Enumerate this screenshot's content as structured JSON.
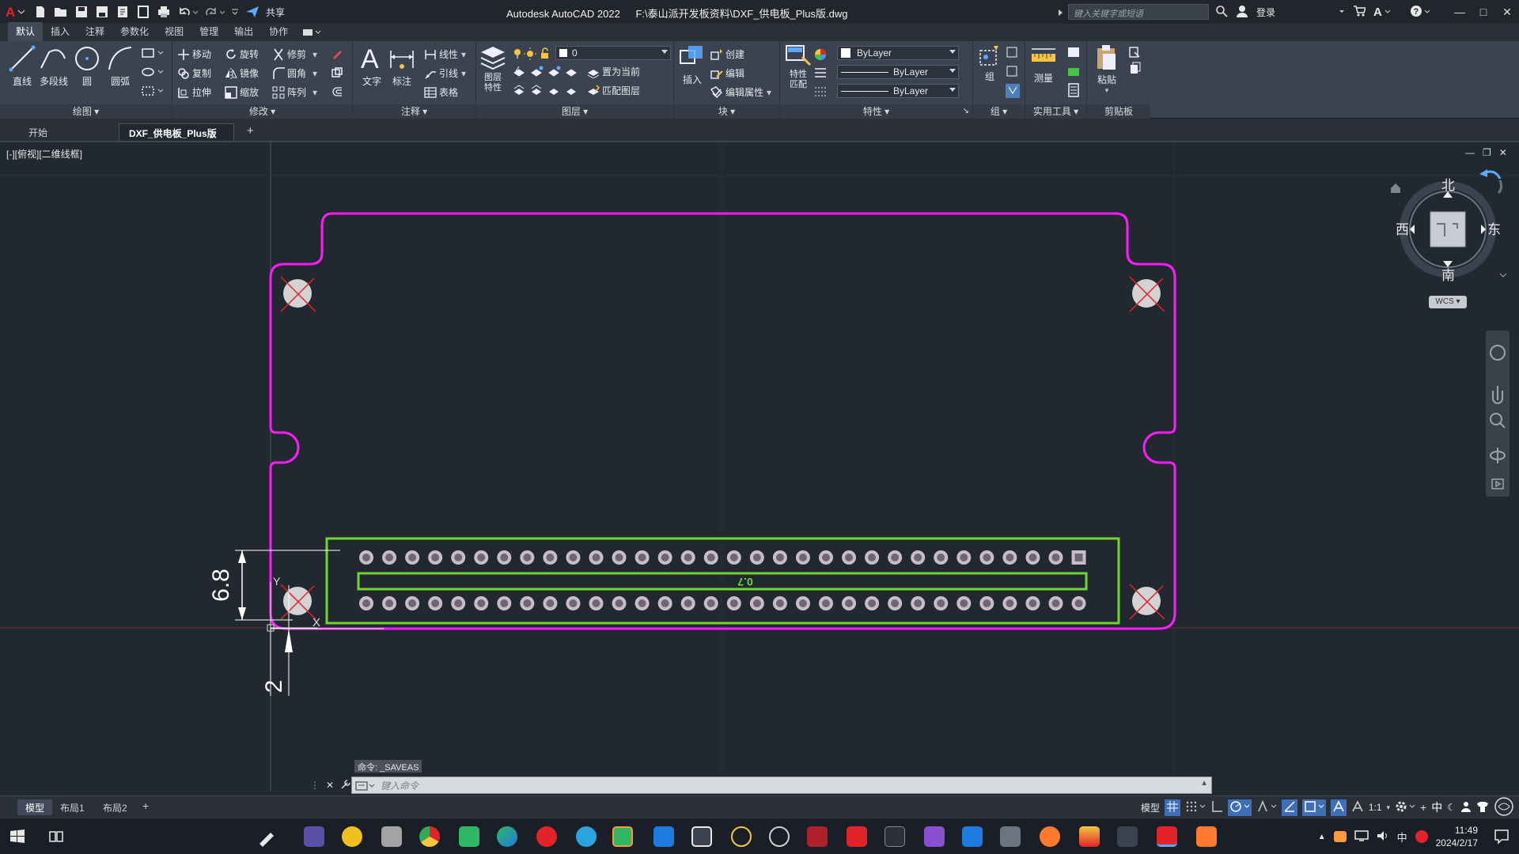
{
  "app": {
    "title": "Autodesk AutoCAD 2022",
    "file_path": "F:\\泰山派开发板资料\\DXF_供电板_Plus版.dwg",
    "share_label": "共享",
    "search_placeholder": "键入关键字或短语",
    "login_label": "登录"
  },
  "ribbon_tabs": [
    "默认",
    "插入",
    "注释",
    "参数化",
    "视图",
    "管理",
    "输出",
    "协作"
  ],
  "ribbon": {
    "draw": {
      "title": "绘图",
      "line": "直线",
      "polyline": "多段线",
      "circle": "圆",
      "arc": "圆弧"
    },
    "modify": {
      "title": "修改",
      "move": "移动",
      "rotate": "旋转",
      "trim": "修剪",
      "copy": "复制",
      "mirror": "镜像",
      "fillet": "圆角",
      "stretch": "拉伸",
      "scale": "缩放",
      "array": "阵列"
    },
    "annotation": {
      "title": "注释",
      "text": "文字",
      "dimension": "标注",
      "linear": "线性",
      "leader": "引线",
      "table": "表格"
    },
    "layers": {
      "title": "图层",
      "layer_props": "图层\n特性",
      "layer_value": "0",
      "set_current": "置为当前",
      "match_layer": "匹配图层"
    },
    "block": {
      "title": "块",
      "insert": "插入",
      "create": "创建",
      "edit": "编辑",
      "edit_attr": "编辑属性"
    },
    "properties": {
      "title": "特性",
      "match": "特性\n匹配",
      "color": "ByLayer",
      "linetype": "ByLayer",
      "lineweight": "ByLayer"
    },
    "group": {
      "title": "组",
      "group": "组"
    },
    "utilities": {
      "title": "实用工具",
      "measure": "测量"
    },
    "clipboard": {
      "title": "剪贴板",
      "paste": "粘贴"
    }
  },
  "doc_tabs": {
    "start": "开始",
    "current": "DXF_供电板_Plus版"
  },
  "viewport": {
    "label": "[-][俯视][二维线框]",
    "dim_vertical": "6.8",
    "dim_bottom": "2",
    "board_text": "0.7",
    "ucs_y": "Y",
    "ucs_x": "X"
  },
  "viewcube": {
    "north": "北",
    "south": "南",
    "east": "东",
    "west": "西",
    "top_face": "上",
    "wcs": "WCS"
  },
  "command": {
    "history": "命令: _SAVEAS",
    "placeholder": "键入命令"
  },
  "layout_tabs": [
    "模型",
    "布局1",
    "布局2"
  ],
  "status": {
    "model": "模型",
    "scale": "1:1",
    "ime": "中"
  },
  "clock": {
    "time": "11:49",
    "date": "2024/2/17"
  },
  "colors": {
    "board_outline": "#ff1aff",
    "header_outline": "#6fd62f",
    "hole_fill": "#d3d3d3",
    "red_mark": "#e2232a",
    "pin": "#c7bcc8"
  }
}
